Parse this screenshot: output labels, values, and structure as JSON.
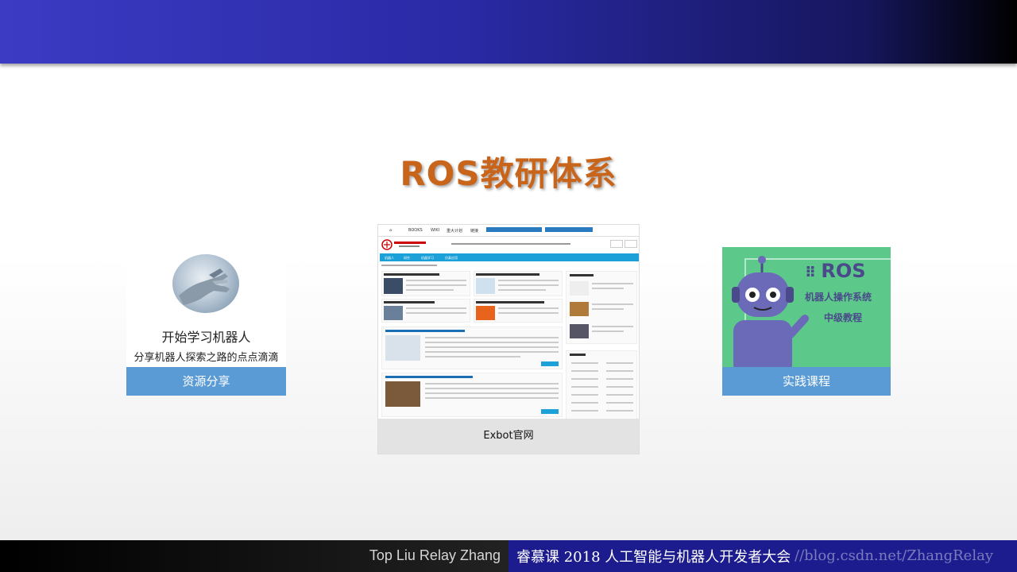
{
  "slide": {
    "title": "ROS教研体系"
  },
  "cards": {
    "left": {
      "line1": "开始学习机器人",
      "line2": "分享机器人探索之路的点点滴滴",
      "label": "资源分享"
    },
    "center": {
      "caption": "Exbot官网",
      "nav_items": [
        "BOOKS",
        "WIKI",
        "重大计划",
        "链接"
      ],
      "menu_items": [
        "机器人",
        "研究",
        "机器学习",
        "仿真应用"
      ]
    },
    "right": {
      "logo": "ROS",
      "line1": "机器人操作系统",
      "line2": "中级教程",
      "label": "实践课程"
    }
  },
  "footer": {
    "authors": "Top Liu  Relay Zhang",
    "event": "睿慕课 2018 人工智能与机器人开发者大会",
    "url": "//blog.csdn.net/ZhangRelay"
  },
  "colors": {
    "title": "#c9651b",
    "card_label_bg": "#5b9bd5",
    "right_card_bg": "#5cc98a",
    "footer_right_bg": "#1c1c8e"
  }
}
